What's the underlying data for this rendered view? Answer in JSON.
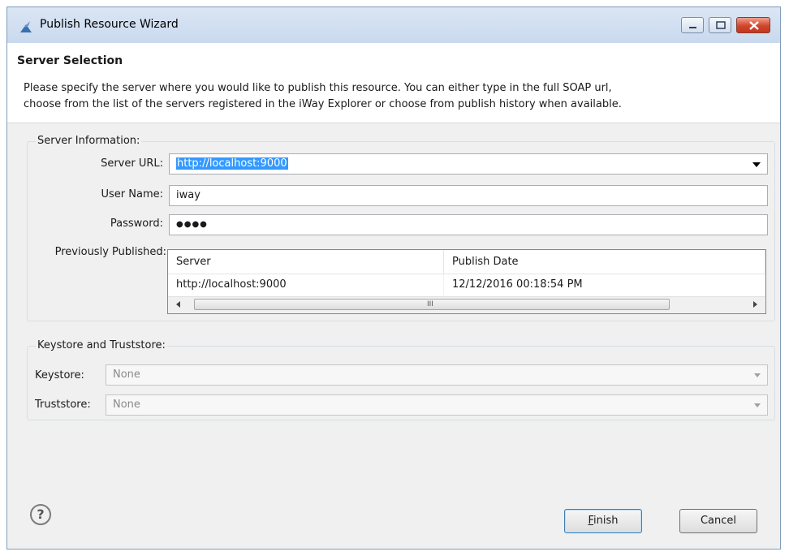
{
  "window": {
    "title": "Publish Resource Wizard"
  },
  "header": {
    "title": "Server Selection",
    "description_line1": "Please specify the server where you would like to publish this resource. You can either type in the full SOAP url,",
    "description_line2": "choose from the list of the servers registered in the iWay Explorer or choose from publish history when available."
  },
  "server_info": {
    "legend": "Server Information:",
    "url_label": "Server URL:",
    "url_value": "http://localhost:9000",
    "username_label": "User Name:",
    "username_value": "iway",
    "password_label": "Password:",
    "password_value": "●●●●",
    "history_label": "Previously Published:",
    "history": {
      "columns": [
        "Server",
        "Publish Date"
      ],
      "rows": [
        [
          "http://localhost:9000",
          "12/12/2016 00:18:54 PM"
        ]
      ],
      "scroll_grip": "III"
    }
  },
  "keystore": {
    "legend": "Keystore and Truststore:",
    "keystore_label": "Keystore:",
    "keystore_value": "None",
    "truststore_label": "Truststore:",
    "truststore_value": "None"
  },
  "buttons": {
    "finish_hotkey": "F",
    "finish_rest": "inish",
    "cancel": "Cancel",
    "help": "?"
  }
}
